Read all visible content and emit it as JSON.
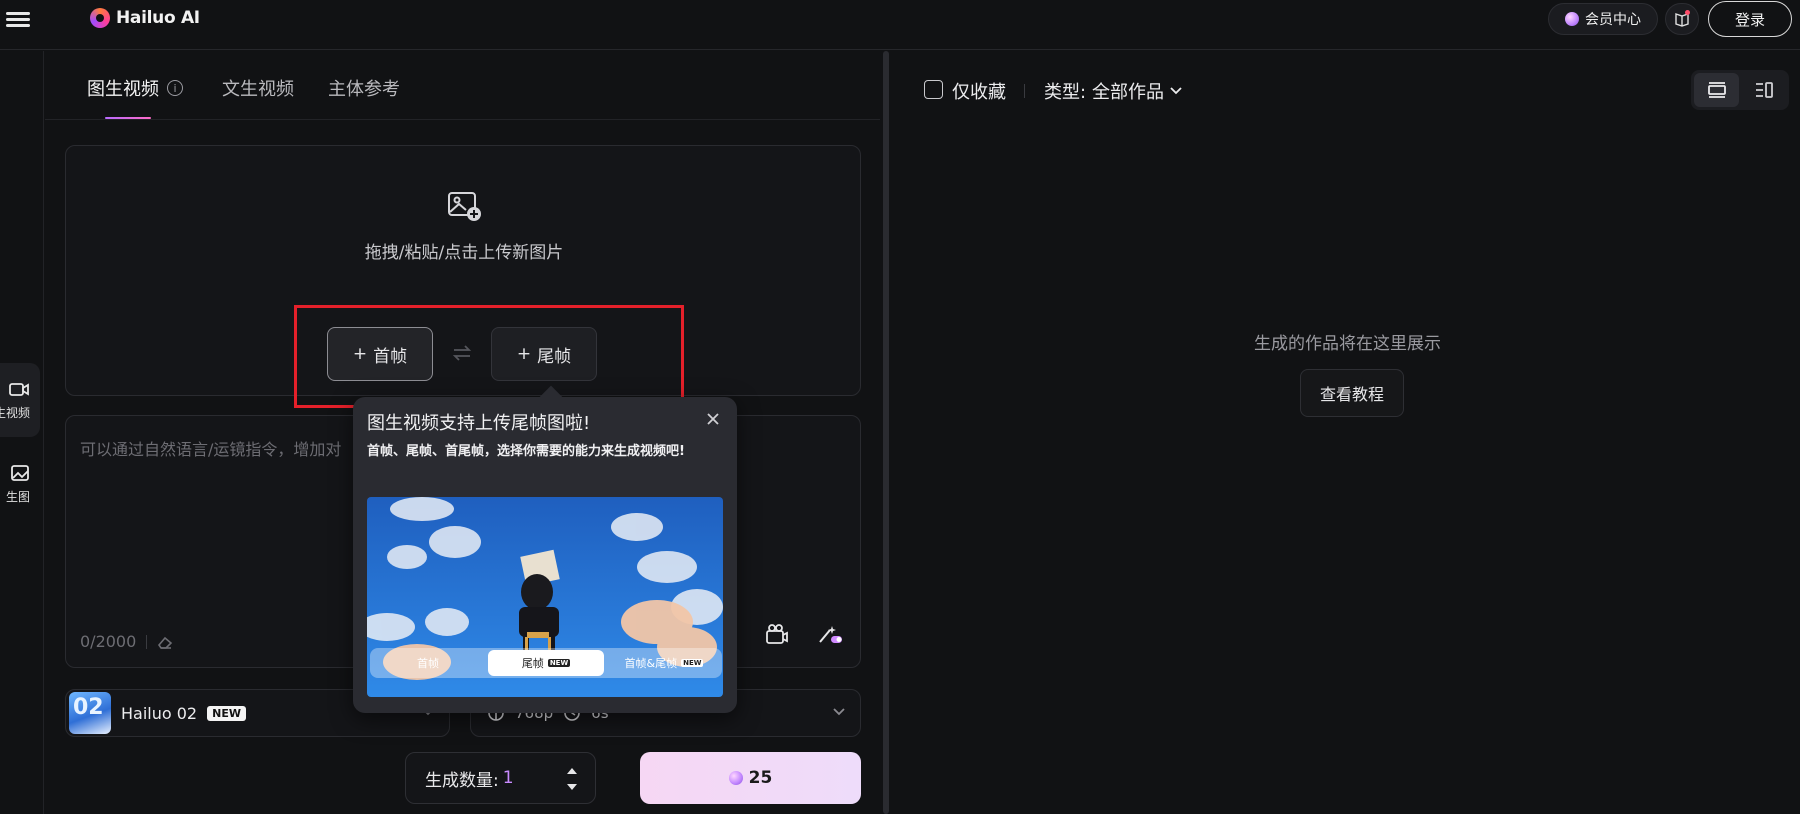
{
  "header": {
    "brand": "Hailuo AI",
    "member_center": "会员中心",
    "login": "登录"
  },
  "rail": {
    "items": [
      {
        "label": "生视频",
        "icon": "video-icon",
        "active": true
      },
      {
        "label": "生图",
        "icon": "image-icon",
        "active": false
      }
    ]
  },
  "tabs": [
    {
      "label": "图生视频",
      "active": true
    },
    {
      "label": "文生视频",
      "active": false
    },
    {
      "label": "主体参考",
      "active": false
    }
  ],
  "upload": {
    "hint": "拖拽/粘贴/点击上传新图片",
    "first_frame": "首帧",
    "last_frame": "尾帧"
  },
  "prompt": {
    "placeholder": "可以通过自然语言/运镜指令，增加对",
    "count": "0/2000"
  },
  "model": {
    "thumb_text": "02",
    "name": "Hailuo 02",
    "badge": "NEW"
  },
  "settings": {
    "resolution": "768p",
    "duration": "6s"
  },
  "quantity": {
    "label": "生成数量:",
    "value": "1"
  },
  "generate": {
    "cost": "25"
  },
  "popover": {
    "title": "图生视频支持上传尾帧图啦!",
    "desc": "首帧、尾帧、首尾帧，选择你需要的能力来生成视频吧!",
    "preview_tabs": [
      {
        "label": "首帧",
        "new": "",
        "selected": false
      },
      {
        "label": "尾帧",
        "new": "NEW",
        "selected": true
      },
      {
        "label": "首帧&尾帧",
        "new": "NEW",
        "selected": false
      }
    ]
  },
  "gallery": {
    "favorites_only": "仅收藏",
    "type_label": "类型:",
    "type_value": "全部作品",
    "empty_text": "生成的作品将在这里展示",
    "tutorial": "查看教程"
  },
  "colors": {
    "accent": "#c98bff",
    "highlight": "#e5202a",
    "background": "#111214"
  }
}
